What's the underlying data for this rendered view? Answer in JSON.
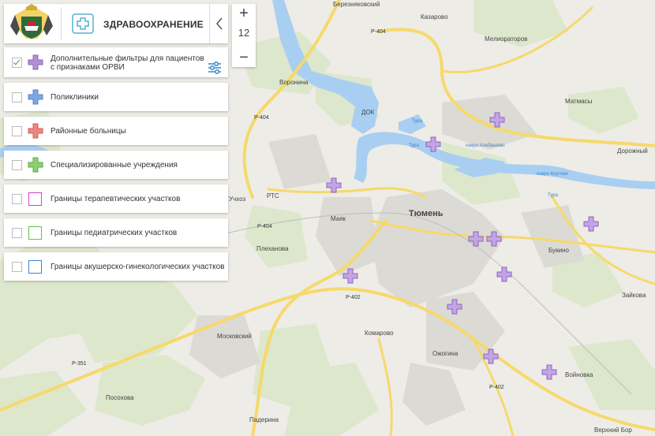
{
  "header": {
    "title": "ЗДРАВООХРАНЕНИЕ"
  },
  "zoom": {
    "in": "+",
    "level": "12",
    "out": "−"
  },
  "filters": [
    {
      "label": "Дополнительные фильтры для пациентов с признаками ОРВИ",
      "checked": true,
      "icon": "plus-icon",
      "color": "#b28fd6"
    },
    {
      "label": "Поликлиники",
      "checked": false,
      "icon": "plus-icon",
      "color": "#7ea6e3"
    },
    {
      "label": "Районные больницы",
      "checked": false,
      "icon": "plus-icon",
      "color": "#ee8580"
    },
    {
      "label": "Специализированные учреждения",
      "checked": false,
      "icon": "plus-icon",
      "color": "#8dce71"
    },
    {
      "label": "Границы терапевтических участков",
      "checked": false,
      "icon": "square-outline-icon",
      "color": "#d33fd0"
    },
    {
      "label": "Границы педиатрических участков",
      "checked": false,
      "icon": "square-outline-icon",
      "color": "#6ac04d"
    },
    {
      "label": "Границы акушерско-гинекологических участков",
      "checked": false,
      "icon": "square-outline-icon",
      "color": "#3d84d9"
    }
  ],
  "map": {
    "places": [
      "Березняковский",
      "Казарово",
      "Мелиораторов",
      "Воронина",
      "ДОК",
      "Матмасы",
      "Дорожный",
      "Учхоз",
      "РТС",
      "Маяк",
      "Тюмень",
      "Плеханова",
      "Букино",
      "Зайкова",
      "Московский",
      "Комарово",
      "Ожогина",
      "Войновка",
      "Посохова",
      "Падерина",
      "Верхний Бор"
    ],
    "roads": [
      "Р-404",
      "Р-404",
      "Р-404",
      "Р-402",
      "Р-402",
      "Р-351"
    ],
    "water": [
      "Тура",
      "Тура",
      "Тура",
      "озеро Алебашево",
      "озеро Круглое"
    ],
    "markers_count": 13
  }
}
